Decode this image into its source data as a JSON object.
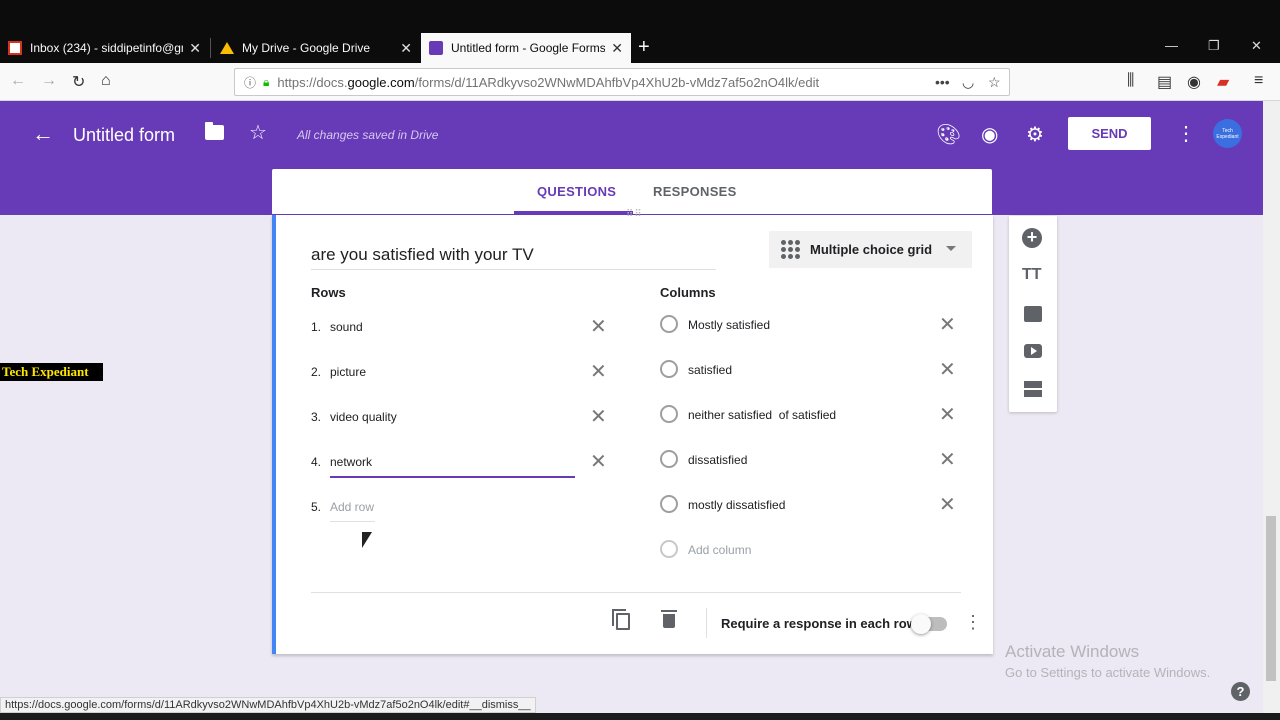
{
  "browser": {
    "tabs": [
      {
        "title": "Inbox (234) - siddipetinfo@gm",
        "favicon": "gmail-icon"
      },
      {
        "title": "My Drive - Google Drive",
        "favicon": "drive-icon"
      },
      {
        "title": "Untitled form - Google Forms",
        "favicon": "forms-icon",
        "active": true
      }
    ],
    "url_prefix": "https://docs.",
    "url_host": "google.com",
    "url_path": "/forms/d/11ARdkyvso2WNwMDAhfbVp4XhU2b-vMdz7af5o2nO4lk/edit",
    "status_url": "https://docs.google.com/forms/d/11ARdkyvso2WNwMDAhfbVp4XhU2b-vMdz7af5o2nO4lk/edit#__dismiss__"
  },
  "header": {
    "title": "Untitled form",
    "saved_status": "All changes saved in Drive",
    "send_label": "SEND",
    "avatar_text": "Tech Expediant",
    "brand_color": "#673ab7"
  },
  "form_tabs": {
    "questions": "QUESTIONS",
    "responses": "RESPONSES"
  },
  "question": {
    "title": "are you satisfied with your TV",
    "type": "Multiple choice grid",
    "rows_label": "Rows",
    "columns_label": "Columns",
    "rows": [
      {
        "num": "1.",
        "text": "sound"
      },
      {
        "num": "2.",
        "text": "picture"
      },
      {
        "num": "3.",
        "text": "video quality"
      },
      {
        "num": "4.",
        "text": "network"
      }
    ],
    "add_row": {
      "num": "5.",
      "text": "Add row"
    },
    "columns": [
      "Mostly satisfied",
      "satisfied",
      "neither satisfied  of satisfied",
      "dissatisfied",
      "mostly dissatisfied"
    ],
    "add_column": "Add column",
    "require_label": "Require a response in each row",
    "require_on": false
  },
  "overlays": {
    "watermark": "Tech Expediant",
    "activate_title": "Activate Windows",
    "activate_sub": "Go to Settings to activate Windows."
  }
}
